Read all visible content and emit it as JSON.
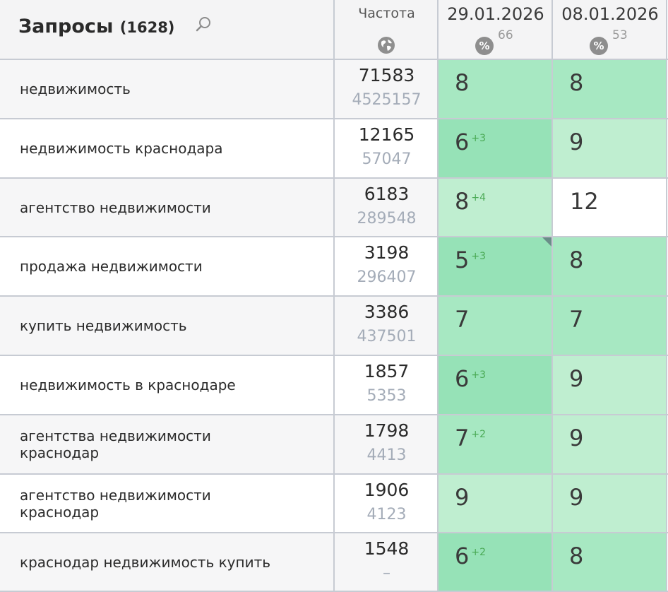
{
  "header": {
    "title": "Запросы",
    "count": "(1628)",
    "frequency_label": "Частота",
    "dates": [
      {
        "label": "29.01.2026",
        "pct_symbol": "%",
        "pct_value": "66"
      },
      {
        "label": "08.01.2026",
        "pct_symbol": "%",
        "pct_value": "53"
      }
    ]
  },
  "colors": {
    "green_light": "#bfeed0",
    "green_mid": "#a7e8c2",
    "green_strong": "#96e2b7",
    "white": "#ffffff",
    "delta": "#4aaa55"
  },
  "rows": [
    {
      "query": [
        "недвижимость"
      ],
      "freq": "71583",
      "freq_sub": "4525157",
      "positions": [
        {
          "value": "8",
          "delta": "",
          "level": "mid"
        },
        {
          "value": "8",
          "delta": "",
          "level": "mid"
        }
      ]
    },
    {
      "query": [
        "недвижимость краснодара"
      ],
      "freq": "12165",
      "freq_sub": "57047",
      "positions": [
        {
          "value": "6",
          "delta": "+3",
          "level": "strong"
        },
        {
          "value": "9",
          "delta": "",
          "level": "light"
        }
      ]
    },
    {
      "query": [
        "агентство недвижимости"
      ],
      "freq": "6183",
      "freq_sub": "289548",
      "positions": [
        {
          "value": "8",
          "delta": "+4",
          "level": "light"
        },
        {
          "value": "12",
          "delta": "",
          "level": "none"
        }
      ]
    },
    {
      "query": [
        "продажа недвижимости"
      ],
      "freq": "3198",
      "freq_sub": "296407",
      "positions": [
        {
          "value": "5",
          "delta": "+3",
          "level": "strong",
          "corner": true
        },
        {
          "value": "8",
          "delta": "",
          "level": "mid"
        }
      ]
    },
    {
      "query": [
        "купить недвижимость"
      ],
      "freq": "3386",
      "freq_sub": "437501",
      "positions": [
        {
          "value": "7",
          "delta": "",
          "level": "mid"
        },
        {
          "value": "7",
          "delta": "",
          "level": "mid"
        }
      ]
    },
    {
      "query": [
        "недвижимость в краснодаре"
      ],
      "freq": "1857",
      "freq_sub": "5353",
      "positions": [
        {
          "value": "6",
          "delta": "+3",
          "level": "strong"
        },
        {
          "value": "9",
          "delta": "",
          "level": "light"
        }
      ]
    },
    {
      "query": [
        "агентства недвижимости",
        "краснодар"
      ],
      "freq": "1798",
      "freq_sub": "4413",
      "positions": [
        {
          "value": "7",
          "delta": "+2",
          "level": "mid"
        },
        {
          "value": "9",
          "delta": "",
          "level": "light"
        }
      ]
    },
    {
      "query": [
        "агентство недвижимости",
        "краснодар"
      ],
      "freq": "1906",
      "freq_sub": "4123",
      "positions": [
        {
          "value": "9",
          "delta": "",
          "level": "light"
        },
        {
          "value": "9",
          "delta": "",
          "level": "light"
        }
      ]
    },
    {
      "query": [
        "краснодар недвижимость купить"
      ],
      "freq": "1548",
      "freq_sub": "–",
      "positions": [
        {
          "value": "6",
          "delta": "+2",
          "level": "strong"
        },
        {
          "value": "8",
          "delta": "",
          "level": "mid"
        }
      ]
    }
  ]
}
